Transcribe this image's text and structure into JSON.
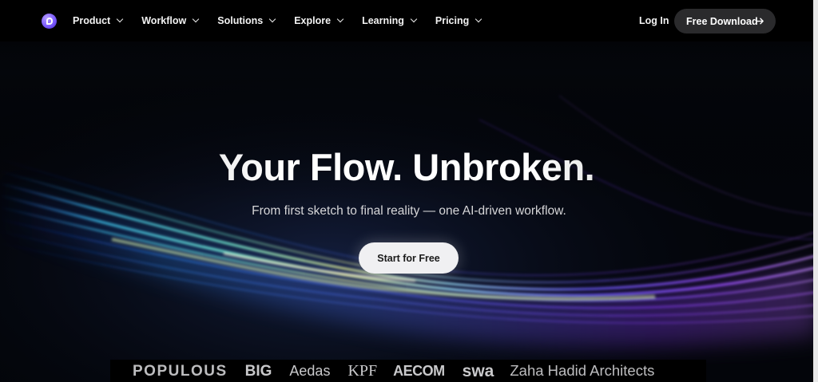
{
  "nav": {
    "items": [
      {
        "label": "Product"
      },
      {
        "label": "Workflow"
      },
      {
        "label": "Solutions"
      },
      {
        "label": "Explore"
      },
      {
        "label": "Learning"
      },
      {
        "label": "Pricing"
      }
    ],
    "login_label": "Log In",
    "download_label": "Free Download"
  },
  "hero": {
    "title": "Your Flow. Unbroken.",
    "subtitle": "From first sketch to final reality — one AI-driven workflow.",
    "cta_label": "Start for Free"
  },
  "clients": {
    "logos": [
      "POPULOUS",
      "BIG",
      "Aedas",
      "KPF",
      "AECOM",
      "swa",
      "Zaha Hadid Architects"
    ]
  },
  "colors": {
    "background": "#000000",
    "accent": "#7c5cff",
    "button_dark": "#2a2a2c",
    "button_light": "#f0f0f2"
  },
  "icons": [
    "logo-icon",
    "chevron-down-icon",
    "arrow-right-icon"
  ]
}
